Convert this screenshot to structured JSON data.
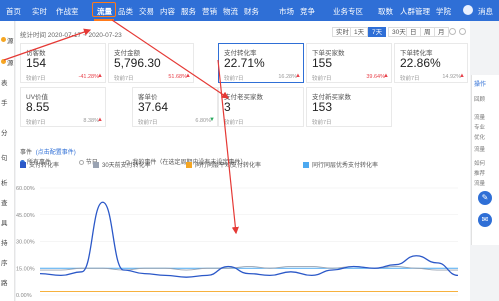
{
  "nav": {
    "items": [
      "首页",
      "实时",
      "作战室",
      "流量",
      "品类",
      "交易",
      "内容",
      "服务",
      "营销",
      "物流",
      "财务",
      "市场",
      "竞争",
      "业务专区",
      "取数",
      "人群管理",
      "学院"
    ],
    "active": "流量",
    "user_label": "消息"
  },
  "sidebar": {
    "items": [
      "源",
      "源",
      "表",
      "手",
      "分",
      "句",
      "析",
      "查",
      "具",
      "持",
      "序",
      "路"
    ]
  },
  "toolbar": {
    "date_range": "统计时间 2020-07-17 ~ 2020-07-23",
    "granularity": [
      "实时",
      "1天",
      "7天",
      "30天",
      "日",
      "周",
      "月"
    ],
    "active_granularity": "7天"
  },
  "cards": [
    {
      "label": "访客数",
      "value": "154",
      "sub": "较前7日",
      "change": "-41.28%",
      "trend": "up"
    },
    {
      "label": "支付金额",
      "value": "5,796.30",
      "sub": "较前7日",
      "change": "51.68%",
      "trend": "up"
    },
    {
      "label": "支付转化率",
      "value": "22.71%",
      "sub": "较前7日",
      "change": "16.28%",
      "trend": "up"
    },
    {
      "label": "下单买家数",
      "value": "155",
      "sub": "较前7日",
      "change": "39.64%",
      "trend": "up"
    },
    {
      "label": "下单转化率",
      "value": "22.86%",
      "sub": "较前7日",
      "change": "14.92%",
      "trend": "up"
    },
    {
      "label": "UV价值",
      "value": "8.55",
      "sub": "较前7日",
      "change": "8.38%",
      "trend": "up"
    },
    {
      "label": "客单价",
      "value": "37.64",
      "sub": "较前7日",
      "change": "6.80%",
      "trend": "down"
    },
    {
      "label": "支付老买家数",
      "value": "3",
      "sub": "较前7日",
      "change": "",
      "trend": ""
    },
    {
      "label": "支付新买家数",
      "value": "153",
      "sub": "较前7日",
      "change": "",
      "trend": ""
    }
  ],
  "events": {
    "title": "事件",
    "link": "点击配置事件",
    "options": [
      "所有事件",
      "节日",
      "我的事件（在选定周期内没有未设定事件）"
    ]
  },
  "legend": [
    {
      "name": "支付转化率",
      "color": "#2b58c8"
    },
    {
      "name": "30天前支付转化率",
      "color": "#9aa3b2"
    },
    {
      "name": "同行同层平均支付转化率",
      "color": "#f5a623"
    },
    {
      "name": "同行同层优秀支付转化率",
      "color": "#4da9f0"
    }
  ],
  "right_panel": {
    "title": "操作",
    "lines": [
      "回顾",
      "流量",
      "专业",
      "优化",
      "流量",
      "如何",
      "推荐",
      "流量"
    ]
  },
  "chart_data": {
    "type": "line",
    "ylim": [
      0,
      60
    ],
    "yticks": [
      "60.00%",
      "45.00%",
      "30.00%",
      "15.00%",
      "0.00%"
    ],
    "series": [
      {
        "name": "支付转化率",
        "values": [
          12,
          11,
          13,
          52,
          14,
          12,
          11,
          10,
          11,
          16,
          12,
          11,
          13,
          11,
          14,
          16,
          15,
          17,
          22,
          18,
          11
        ]
      },
      {
        "name": "30天前支付转化率",
        "values": [
          14,
          14,
          15,
          15,
          14,
          15,
          15,
          14,
          15,
          15,
          16,
          15,
          16,
          16,
          15,
          16,
          15,
          16,
          15,
          14,
          14
        ]
      },
      {
        "name": "同行同层平均支付转化率",
        "values": [
          2,
          2,
          2,
          2,
          2,
          2,
          2,
          2,
          2,
          2,
          2,
          2,
          2,
          2,
          2,
          2,
          2,
          2,
          2,
          2,
          2
        ]
      },
      {
        "name": "同行同层优秀支付转化率",
        "values": [
          15,
          15,
          15,
          15,
          15,
          15,
          15,
          15,
          15,
          15,
          15,
          15,
          15,
          15,
          15,
          15,
          15,
          15,
          15,
          15,
          15
        ]
      }
    ]
  },
  "annotation_color": "#e53935"
}
